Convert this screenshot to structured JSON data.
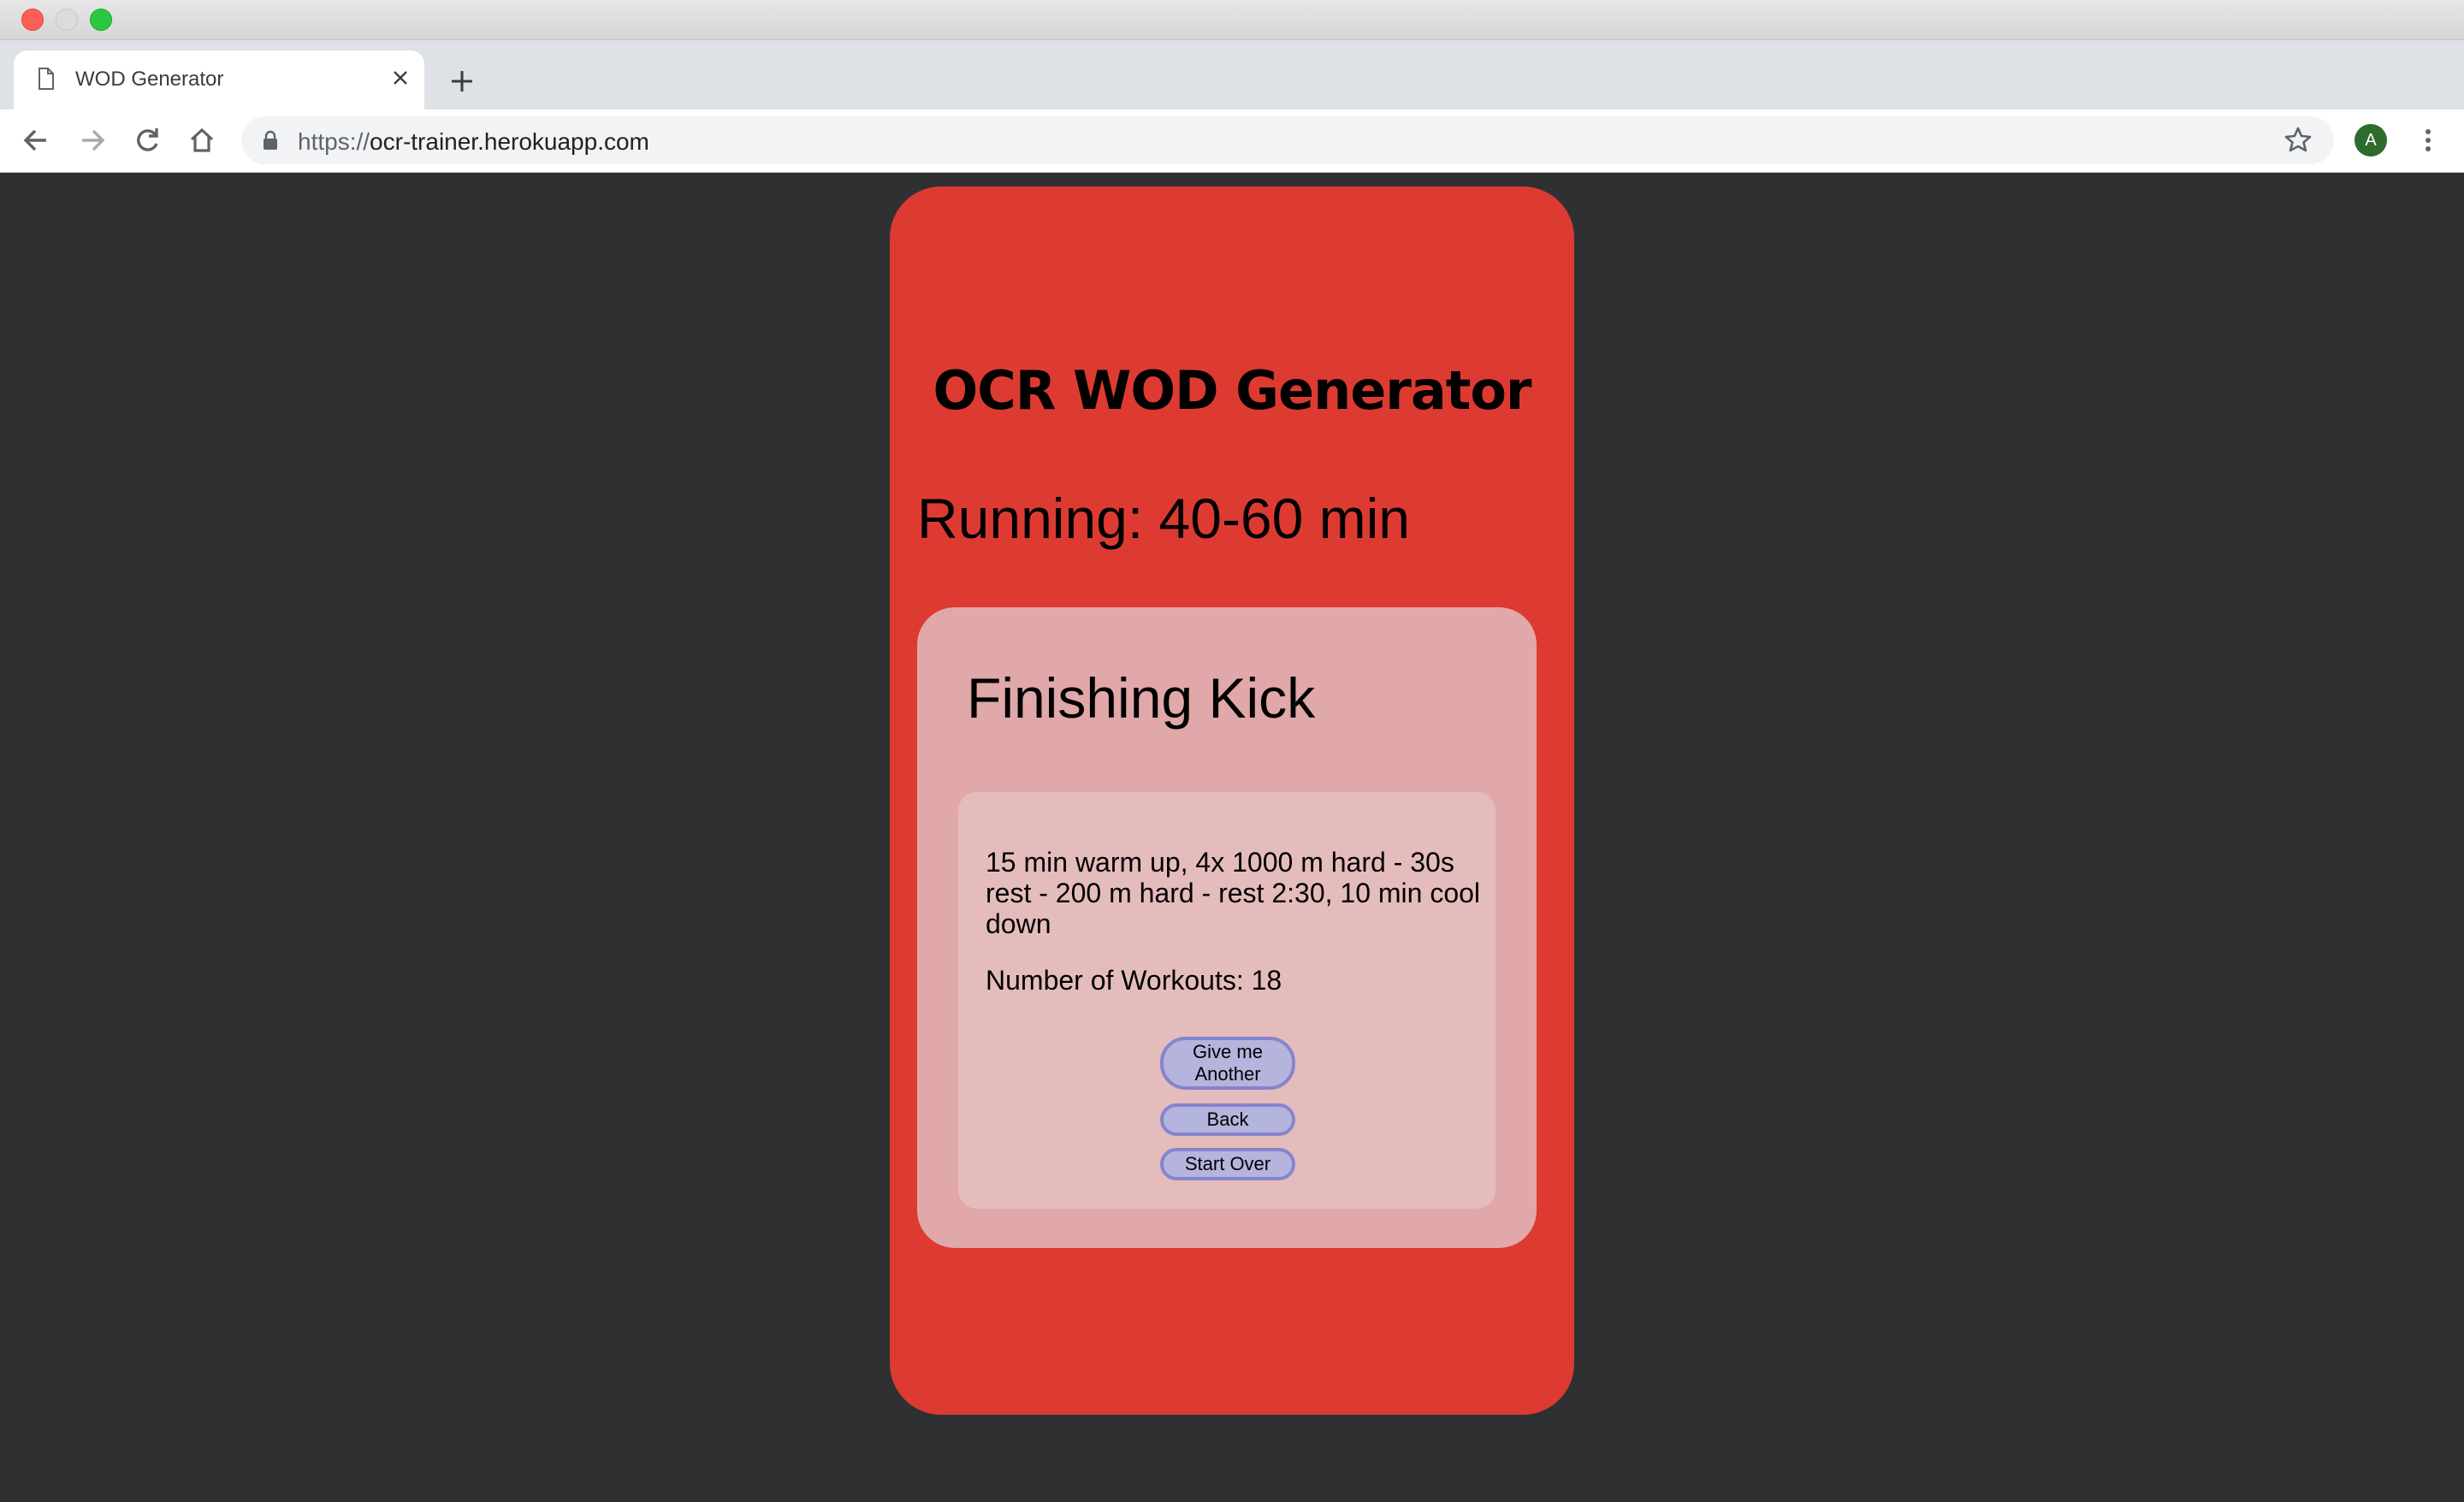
{
  "browser": {
    "tab": {
      "title": "WOD Generator"
    },
    "address_bar": {
      "scheme": "https://",
      "host": "ocr-trainer.herokuapp.com"
    },
    "profile_initial": "A"
  },
  "app": {
    "title": "OCR WOD Generator",
    "category_heading": "Running: 40-60 min",
    "workout": {
      "name": "Finishing Kick",
      "description": "15 min warm up, 4x 1000 m hard - 30s rest - 200 m hard - rest 2:30, 10 min cool down",
      "count_text": "Number of Workouts: 18"
    },
    "buttons": {
      "another": "Give me Another",
      "back": "Back",
      "start_over": "Start Over"
    }
  },
  "colors": {
    "page_background": "#2f3032",
    "card": "#dd3b32",
    "panel": "#e0a8a8",
    "detail_box": "#e5bcbc",
    "button": "#b4b4dc",
    "button_border": "#8585cd"
  },
  "icons": [
    "page-icon",
    "close-icon",
    "plus-icon",
    "back-arrow-icon",
    "forward-arrow-icon",
    "reload-icon",
    "home-icon",
    "lock-icon",
    "star-icon",
    "kebab-menu-icon"
  ]
}
